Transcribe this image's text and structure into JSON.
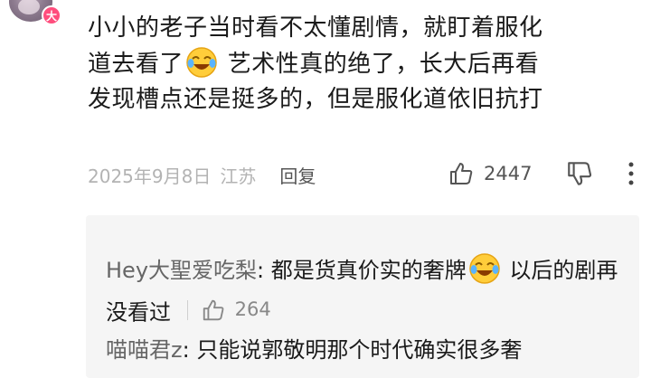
{
  "user": {
    "badge": "大"
  },
  "comment": {
    "line1": "小小的老子当时看不太懂剧情，就盯着服化",
    "line2a": "道去看了",
    "line2b": " 艺术性真的绝了，长大后再看",
    "line3": "发现槽点还是挺多的，但是服化道依旧抗打",
    "emoji": "laugh-cry-emoji"
  },
  "meta": {
    "date": "2025年9月8日",
    "location": "江苏",
    "reply_label": "回复",
    "like_count": "2447"
  },
  "replies": [
    {
      "name": "Hey大聖爱吃梨",
      "text_a": "都是货真价实的奢牌",
      "text_b": " 以后的剧再没看过",
      "like_count": "264"
    },
    {
      "name": "喵喵君z",
      "text": "只能说郭敬明那个时代确实很多奢"
    }
  ],
  "colors": {
    "meta": "#b3b3b3",
    "reply_bg": "#f5f5f5",
    "badge": "#ff4d7d"
  }
}
